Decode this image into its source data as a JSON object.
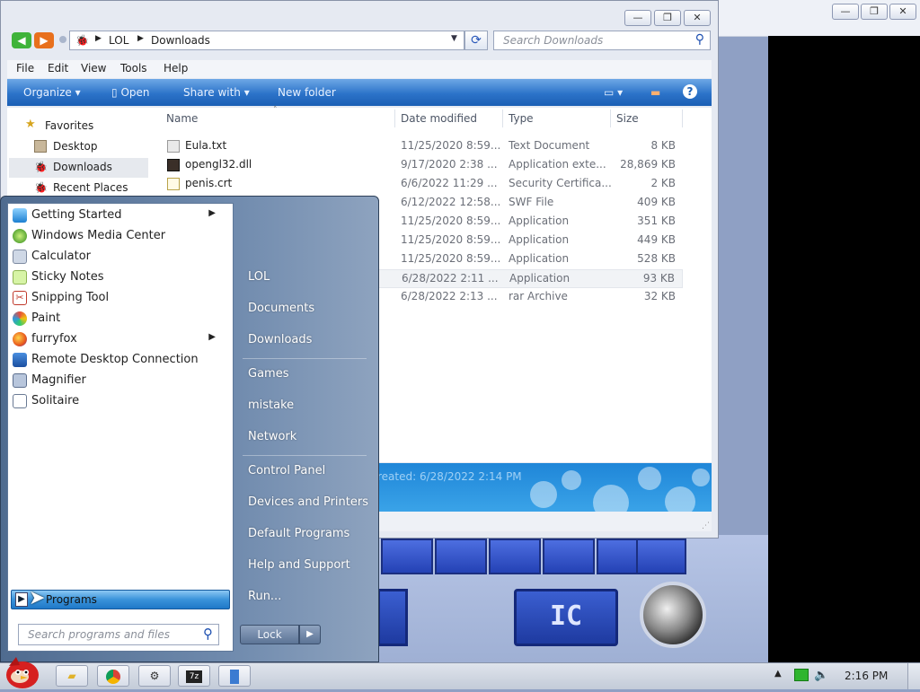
{
  "explorer": {
    "breadcrumb": [
      "LOL",
      "Downloads"
    ],
    "search_placeholder": "Search Downloads",
    "menu": [
      "File",
      "Edit",
      "View",
      "Tools",
      "Help"
    ],
    "toolbar": {
      "organize": "Organize",
      "open": "Open",
      "share_with": "Share with",
      "new_folder": "New folder"
    },
    "nav": [
      {
        "label": "Favorites"
      },
      {
        "label": "Desktop"
      },
      {
        "label": "Downloads"
      },
      {
        "label": "Recent Places"
      }
    ],
    "columns": {
      "name": "Name",
      "date": "Date modified",
      "type": "Type",
      "size": "Size"
    },
    "files": [
      {
        "name": "Eula.txt",
        "date": "11/25/2020 8:59...",
        "type": "Text Document",
        "size": "8 KB"
      },
      {
        "name": "opengl32.dll",
        "date": "9/17/2020 2:38 ...",
        "type": "Application exte...",
        "size": "28,869 KB"
      },
      {
        "name": "penis.crt",
        "date": "6/6/2022 11:29 ...",
        "type": "Security Certifica...",
        "size": "2 KB"
      },
      {
        "name": "",
        "date": "6/12/2022 12:58...",
        "type": "SWF File",
        "size": "409 KB"
      },
      {
        "name": "",
        "date": "11/25/2020 8:59...",
        "type": "Application",
        "size": "351 KB"
      },
      {
        "name": "",
        "date": "11/25/2020 8:59...",
        "type": "Application",
        "size": "449 KB"
      },
      {
        "name": "",
        "date": "11/25/2020 8:59...",
        "type": "Application",
        "size": "528 KB"
      },
      {
        "name": "",
        "date": "6/28/2022 2:11 ...",
        "type": "Application",
        "size": "93 KB"
      },
      {
        "name": "",
        "date": "6/28/2022 2:13 ...",
        "type": "rar Archive",
        "size": "32 KB"
      }
    ],
    "details_text": "reated: 6/28/2022 2:14 PM"
  },
  "start_menu": {
    "programs": [
      {
        "label": "Getting Started",
        "submenu": true
      },
      {
        "label": "Windows Media Center",
        "submenu": false
      },
      {
        "label": "Calculator",
        "submenu": false
      },
      {
        "label": "Sticky Notes",
        "submenu": false
      },
      {
        "label": "Snipping Tool",
        "submenu": false
      },
      {
        "label": "Paint",
        "submenu": false
      },
      {
        "label": "furryfox",
        "submenu": true
      },
      {
        "label": "Remote Desktop Connection",
        "submenu": false
      },
      {
        "label": "Magnifier",
        "submenu": false
      },
      {
        "label": "Solitaire",
        "submenu": false
      }
    ],
    "all_programs_label": "Programs",
    "search_placeholder": "Search programs and files",
    "right_links": [
      "LOL",
      "Documents",
      "Downloads",
      "Games",
      "mistake",
      "Network",
      "Control Panel",
      "Devices and Printers",
      "Default Programs",
      "Help and Support",
      "Run..."
    ],
    "lock_label": "Lock"
  },
  "game": {
    "button_label": "IC"
  },
  "taskbar": {
    "clock": "2:16 PM"
  }
}
